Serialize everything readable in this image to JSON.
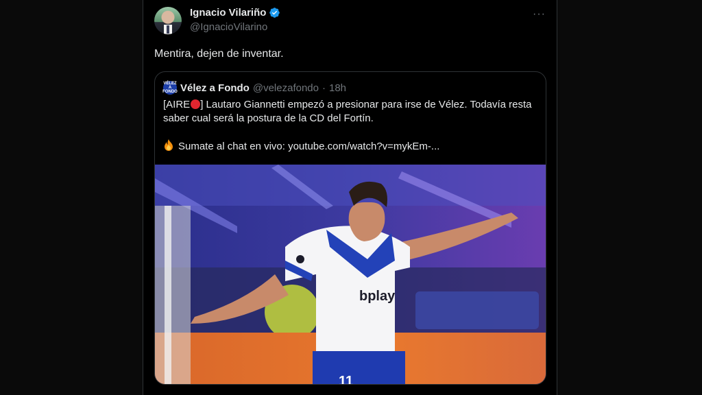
{
  "tweet": {
    "author_name": "Ignacio Vilariño",
    "author_handle": "@IgnacioVilarino",
    "text": "Mentira, dejen de inventar.",
    "more_label": "···"
  },
  "quote": {
    "author_name": "Vélez a Fondo",
    "author_handle": "@velezafondo",
    "separator": "·",
    "time": "18h",
    "avatar_text": "VÉLEZ A FONDO",
    "line1_prefix": "[AIRE",
    "line1_rest": "] Lautaro Giannetti empezó a presionar para irse de Vélez. Todavía resta saber cual será la postura de la CD del Fortín.",
    "line2": "Sumate al chat en vivo: youtube.com/watch?v=mykEm-...",
    "media": {
      "sponsor_text": "bplay",
      "number_text": "11"
    }
  },
  "colors": {
    "background": "#000000",
    "text": "#e7e9ea",
    "secondary": "#71767b",
    "verified": "#1d9bf0",
    "border": "#2f3336"
  }
}
